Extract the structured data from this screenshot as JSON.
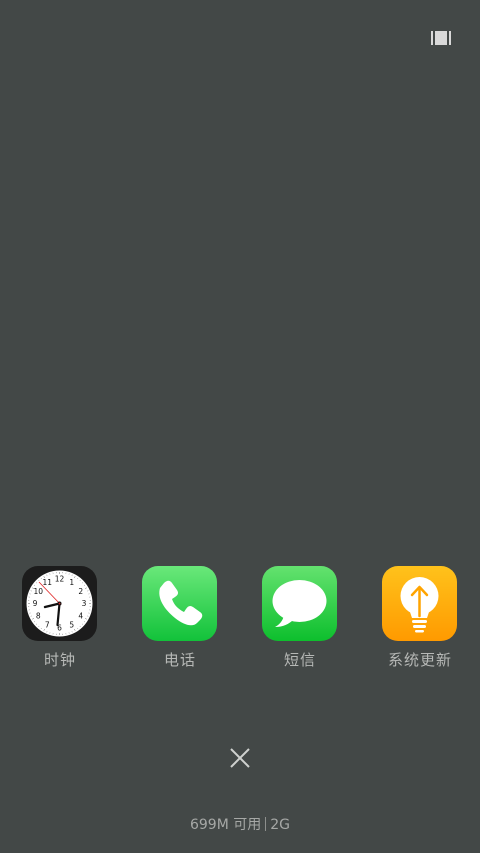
{
  "top": {
    "toggle_icon": "recent-view-toggle-icon"
  },
  "apps": [
    {
      "label": "时钟",
      "icon": "clock-icon"
    },
    {
      "label": "电话",
      "icon": "phone-icon"
    },
    {
      "label": "短信",
      "icon": "message-icon"
    },
    {
      "label": "系统更新",
      "icon": "system-update-icon"
    }
  ],
  "clock": {
    "numbers": [
      "12",
      "1",
      "2",
      "3",
      "4",
      "5",
      "6",
      "7",
      "8",
      "9",
      "10",
      "11"
    ]
  },
  "footer": {
    "memory": "699M 可用",
    "ram": "2G"
  },
  "colors": {
    "background": "#434847",
    "label": "#b6b8b6",
    "clock_second_hand": "#e02a2a"
  }
}
